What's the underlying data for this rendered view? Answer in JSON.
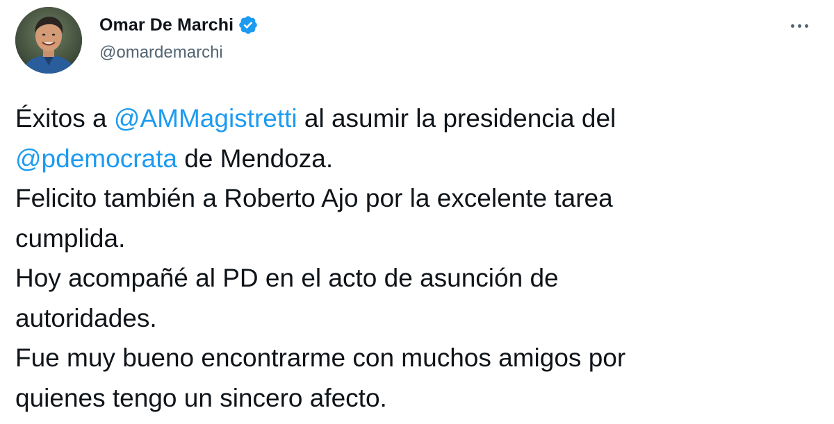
{
  "author": {
    "name": "Omar De Marchi",
    "handle": "@omardemarchi",
    "verified": true,
    "avatar_icon": "profile-photo-icon",
    "verified_icon": "verified-badge-icon"
  },
  "more_menu": {
    "icon": "more-options-icon"
  },
  "tweet": {
    "line1": {
      "prefix": "Éxitos a ",
      "mention": "@AMMagistretti",
      "suffix": " al asumir la presidencia del"
    },
    "line2": {
      "mention": "@pdemocrata",
      "suffix": " de Mendoza."
    },
    "line3": "Felicito también a Roberto Ajo por la excelente tarea",
    "line4": "cumplida.",
    "line5": "Hoy acompañé al PD en el acto de asunción de",
    "line6": "autoridades.",
    "line7": "Fue muy bueno encontrarme con muchos amigos por",
    "line8": "quienes tengo un sincero afecto."
  },
  "colors": {
    "link": "#1d9bf0",
    "text": "#0f1419",
    "secondary": "#536471",
    "verified": "#1d9bf0"
  }
}
